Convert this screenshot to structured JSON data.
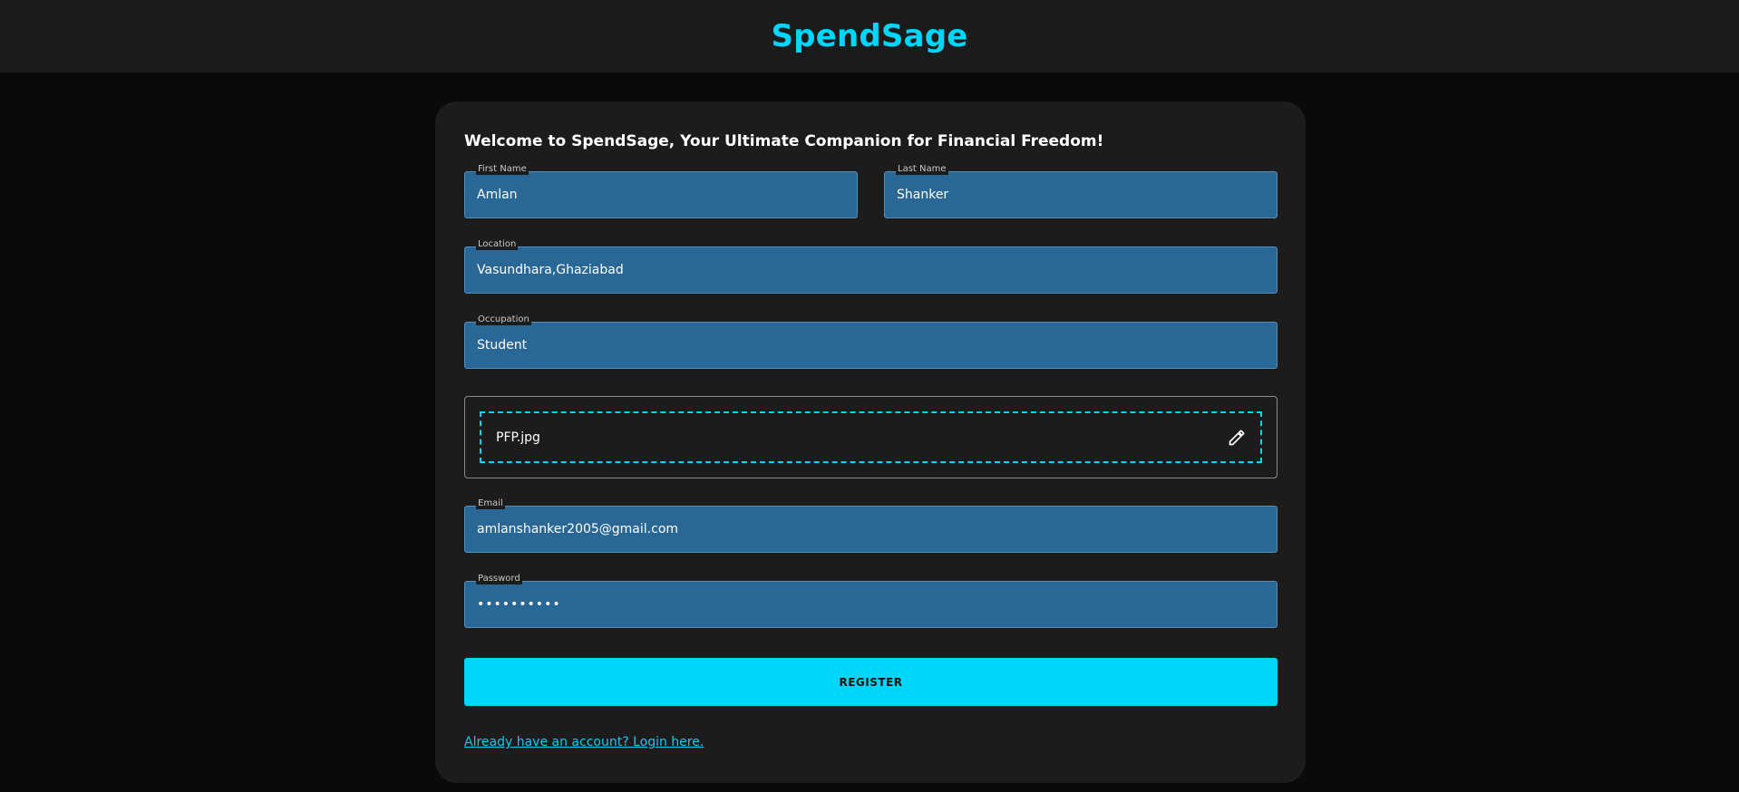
{
  "header": {
    "brand": "SpendSage"
  },
  "form": {
    "welcome": "Welcome to SpendSage, Your Ultimate Companion for Financial Freedom!",
    "first_name": {
      "label": "First Name",
      "value": "Amlan"
    },
    "last_name": {
      "label": "Last Name",
      "value": "Shanker"
    },
    "location": {
      "label": "Location",
      "value": "Vasundhara,Ghaziabad"
    },
    "occupation": {
      "label": "Occupation",
      "value": "Student"
    },
    "picture": {
      "filename": "PFP.jpg",
      "icon": "pencil-edit-icon"
    },
    "email": {
      "label": "Email",
      "value": "amlanshanker2005@gmail.com"
    },
    "password": {
      "label": "Password",
      "value": "••••••••••"
    },
    "register_label": "REGISTER",
    "login_link": "Already have an account? Login here."
  },
  "colors": {
    "accent": "#00d5fa",
    "field_bg": "#286796",
    "card_bg": "#1c1c1c",
    "page_bg": "#0a0a0a",
    "header_bg": "#1b1b1b"
  }
}
